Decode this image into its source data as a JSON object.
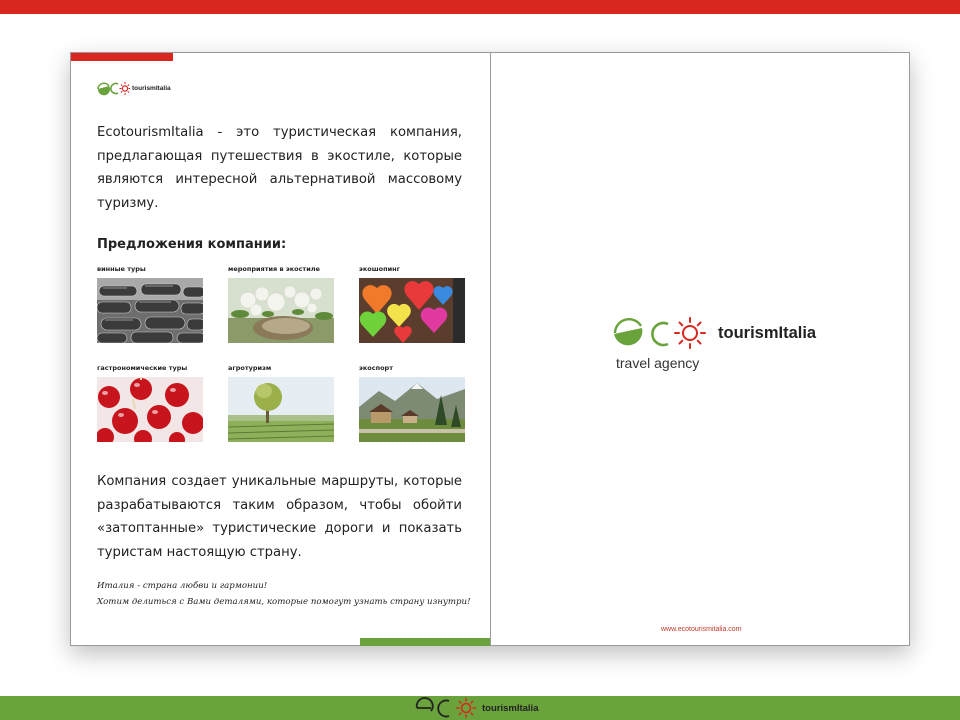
{
  "colors": {
    "brand_red": "#d9271f",
    "brand_green": "#6aa33b"
  },
  "logo": {
    "wordmark": "tourismItalia"
  },
  "left_page": {
    "intro_text": "EcotourismItalia - это туристическая компания, предлагающая путешествия в экостиле, которые являются интересной альтернативой массовому туризму.",
    "offers_title": "Предложения компании:",
    "offers": [
      {
        "label": "винные туры",
        "icon": "wine-bottles-photo"
      },
      {
        "label": "мероприятия в экостиле",
        "icon": "flowers-table-photo"
      },
      {
        "label": "экошопинг",
        "icon": "felt-hearts-photo"
      },
      {
        "label": "гастрономические туры",
        "icon": "candy-apples-photo"
      },
      {
        "label": "агротуризм",
        "icon": "vineyard-photo"
      },
      {
        "label": "экоспорт",
        "icon": "mountain-village-photo"
      }
    ],
    "body_text": "Компания создает уникальные маршруты, которые разрабатываются таким образом, чтобы обойти «затоптанные» туристические дороги и показать туристам настоящую страну.",
    "script_line_1": "Италия - страна любви и гармонии!",
    "script_line_2": "Хотим делиться с Вами деталями, которые помогут узнать страну изнутри!"
  },
  "right_page": {
    "tagline": "travel agency",
    "url": "www.ecotourismitalia.com"
  }
}
